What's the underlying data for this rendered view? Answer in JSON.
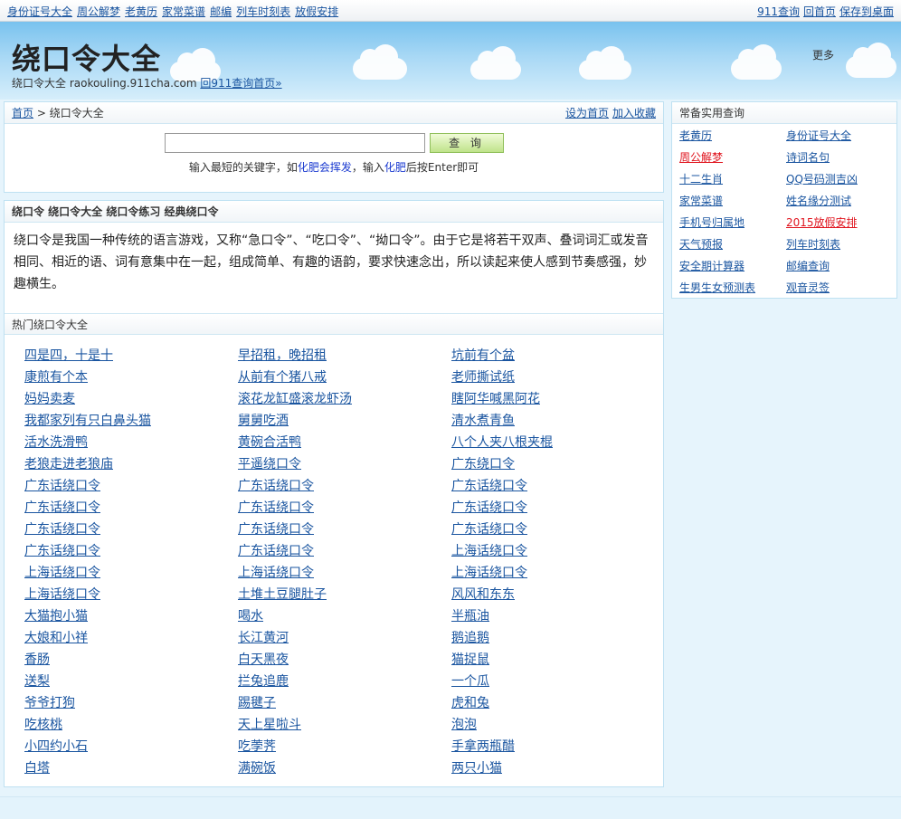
{
  "topbar": {
    "left_links": [
      "身份证号大全",
      "周公解梦",
      "老黄历",
      "家常菜谱",
      "邮编",
      "列车时刻表",
      "放假安排"
    ],
    "right_links": [
      "911查询",
      "回首页",
      "保存到桌面"
    ]
  },
  "header": {
    "title": "绕口令大全",
    "subtitle": "绕口令大全 raokouling.911cha.com",
    "back_link": "回911查询首页»",
    "more": "更多"
  },
  "breadcrumb": {
    "home": "首页",
    "sep": " > ",
    "current": "绕口令大全",
    "set_home": "设为首页",
    "add_favorite": "加入收藏"
  },
  "search": {
    "value": "",
    "button": "查 询",
    "hint_prefix": "输入最短的关键字，如",
    "hint_kw1": "化肥会挥发",
    "hint_mid": "，输入",
    "hint_kw2": "化肥",
    "hint_suffix": "后按Enter即可"
  },
  "intro": {
    "title": "绕口令 绕口令大全 绕口令练习 经典绕口令",
    "text": "绕口令是我国一种传统的语言游戏，又称“急口令”、“吃口令”、“拗口令”。由于它是将若干双声、叠词词汇或发音相同、相近的语、词有意集中在一起，组成简单、有趣的语韵，要求快速念出，所以读起来使人感到节奏感强，妙趣横生。"
  },
  "hot": {
    "title": "热门绕口令大全",
    "items": [
      "四是四，十是十",
      "早招租，晚招租",
      "坑前有个盆",
      "康煎有个本",
      "从前有个猪八戒",
      "老师撕试纸",
      "妈妈卖麦",
      "滚花龙缸盛滚龙虾汤",
      "瞎阿华喊黑阿花",
      "我都家列有只白鼻头猫",
      "舅舅吃酒",
      "清水煮青鱼",
      "活水洗滑鸭",
      "黄碗合活鸭",
      "八个人夹八根夹棍",
      "老狼走进老狼庙",
      "平遥绕口令",
      "广东绕口令",
      "广东话绕口令",
      "广东话绕口令",
      "广东话绕口令",
      "广东话绕口令",
      "广东话绕口令",
      "广东话绕口令",
      "广东话绕口令",
      "广东话绕口令",
      "广东话绕口令",
      "广东话绕口令",
      "广东话绕口令",
      "上海话绕口令",
      "上海话绕口令",
      "上海话绕口令",
      "上海话绕口令",
      "上海话绕口令",
      "土堆土豆腿肚子",
      "风风和东东",
      "大猫抱小猫",
      "喝水",
      "半瓶油",
      "大娘和小祥",
      "长江黄河",
      "鹅追鹅",
      "香肠",
      "白天黑夜",
      "猫捉鼠",
      "送梨",
      "拦兔追鹿",
      "一个瓜",
      "爷爷打狗",
      "踢毽子",
      "虎和兔",
      "吃核桃",
      "天上星啦斗",
      "泡泡",
      "小四约小石",
      "吃荸荠",
      "手拿两瓶醋",
      "白塔",
      "满碗饭",
      "两只小猫"
    ]
  },
  "sidebar": {
    "title": "常备实用查询",
    "links": [
      {
        "label": "老黄历",
        "highlight": false
      },
      {
        "label": "身份证号大全",
        "highlight": false
      },
      {
        "label": "周公解梦",
        "highlight": true
      },
      {
        "label": "诗词名句",
        "highlight": false
      },
      {
        "label": "十二生肖",
        "highlight": false
      },
      {
        "label": "QQ号码测吉凶",
        "highlight": false
      },
      {
        "label": "家常菜谱",
        "highlight": false
      },
      {
        "label": "姓名缘分测试",
        "highlight": false
      },
      {
        "label": "手机号归属地",
        "highlight": false
      },
      {
        "label": "2015放假安排",
        "highlight": true
      },
      {
        "label": "天气预报",
        "highlight": false
      },
      {
        "label": "列车时刻表",
        "highlight": false
      },
      {
        "label": "安全期计算器",
        "highlight": false
      },
      {
        "label": "邮编查询",
        "highlight": false
      },
      {
        "label": "生男生女预测表",
        "highlight": false
      },
      {
        "label": "观音灵签",
        "highlight": false
      }
    ]
  },
  "colors": {
    "link": "#1a55a0",
    "highlight": "#e0141e",
    "sky": "#79c2ee"
  }
}
